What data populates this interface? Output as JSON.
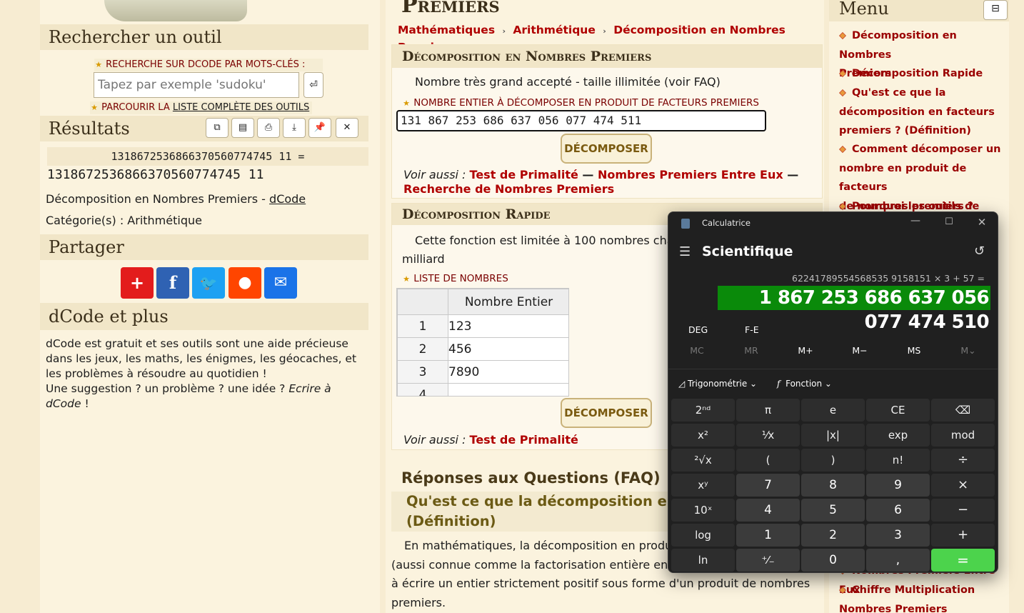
{
  "left": {
    "search_heading": "Rechercher un outil",
    "search_label": "RECHERCHE SUR DCODE PAR MOTS-CLÉS :",
    "search_placeholder": "Tapez par exemple 'sudoku'",
    "search_submit": "⏎",
    "browse_prefix": "PARCOURIR LA ",
    "browse_link": "LISTE COMPLÈTE DES OUTILS",
    "results_heading": "Résultats",
    "result_input": "1318672536866370560774745 11 =",
    "result_value": "1318672536866370560774745 11",
    "tool_name": "Décomposition en Nombres Premiers - ",
    "tool_link": "dCode",
    "category": "Catégorie(s) : Arithmétique",
    "share_heading": "Partager",
    "more_heading": "dCode et plus",
    "more_text_1": "dCode est gratuit et ses outils sont une aide précieuse dans les jeux, les maths, les énigmes, les géocaches, et les problèmes à résoudre au quotidien !",
    "more_text_2": "Une suggestion ? un problème ? une idée ? ",
    "more_text_link": "Ecrire à dCode",
    "more_text_end": " !"
  },
  "main": {
    "page_title": "Premiers",
    "breadcrumb": [
      "Mathématiques",
      "Arithmétique",
      "Décomposition en Nombres Premiers"
    ],
    "s1_heading": "Décomposition en Nombres Premiers",
    "s1_note": "Nombre très grand accepté - taille illimitée (voir FAQ)",
    "s1_label": "NOMBRE ENTIER À DÉCOMPOSER EN PRODUIT DE FACTEURS PREMIERS",
    "s1_input_value": "131 867 253 686 637 056 077 474 511",
    "s1_button": "DÉCOMPOSER",
    "see_also": "Voir aussi : ",
    "s1_links": [
      "Test de Primalité",
      "Nombres Premiers Entre Eux",
      "Recherche de Nombres Premiers"
    ],
    "s1_sep": " — ",
    "s2_heading": "Décomposition Rapide",
    "s2_note_1": "Cette fonction est limitée à 100 nombres cha",
    "s2_note_2": "milliard",
    "s2_label": "LISTE DE NOMBRES",
    "s2_col_header": "Nombre Entier",
    "s2_rows": [
      {
        "n": "1",
        "v": "123"
      },
      {
        "n": "2",
        "v": "456"
      },
      {
        "n": "3",
        "v": "7890"
      },
      {
        "n": "4",
        "v": ""
      }
    ],
    "s2_button": "DÉCOMPOSER",
    "s2_link": "Test de Primalité",
    "faq_heading": "Réponses aux Questions (FAQ)",
    "faq_q1_line1": "Qu'est ce que la décomposition en fa",
    "faq_q1_line2": "(Définition)",
    "faq_text_1": "En mathématiques, la décomposition en produ",
    "faq_text_2": "(aussi connue comme la factorisation entière en",
    "faq_text_3": "à écrire un entier strictement positif sous forme d'un produit de nombres",
    "faq_text_4": "premiers."
  },
  "menu": {
    "heading": "Menu",
    "toggle": "⊟",
    "items": [
      "Décomposition en Nombres",
      "Premiers",
      "Décomposition Rapide",
      "Qu'est ce que la",
      "décomposition en facteurs",
      "premiers ? (Définition)",
      "Comment décomposer un",
      "nombre en produit de facteurs",
      "de nombres premiers ?",
      "Pourquoi les outils de"
    ],
    "bottom_items": [
      "Nombres Premiers Entre Eux",
      "Chiffre Multiplication",
      "Nombres Premiers"
    ]
  },
  "calculator": {
    "window_title": "Calculatrice",
    "mode": "Scientifique",
    "expression": "62241789554568535 9158151 × 3 + 57 =",
    "display": "1 867 253 686 637 056 077 474 510",
    "deg": "DEG",
    "fe": "F-E",
    "memory": [
      "MC",
      "MR",
      "M+",
      "M−",
      "MS",
      "M⌄"
    ],
    "trig": "Trigonométrie",
    "func": "Fonction",
    "keys": [
      [
        "2ⁿᵈ",
        "π",
        "e",
        "CE",
        "⌫"
      ],
      [
        "x²",
        "¹⁄x",
        "|x|",
        "exp",
        "mod"
      ],
      [
        "²√x",
        "(",
        ")",
        "n!",
        "÷"
      ],
      [
        "xʸ",
        "7",
        "8",
        "9",
        "×"
      ],
      [
        "10ˣ",
        "4",
        "5",
        "6",
        "−"
      ],
      [
        "log",
        "1",
        "2",
        "3",
        "+"
      ],
      [
        "ln",
        "⁺⁄₋",
        "0",
        ",",
        "="
      ]
    ]
  },
  "colors": {
    "accent_red": "#b00000",
    "calc_display_bg": "#0a8a0a",
    "calc_equals": "#4cd34c"
  }
}
